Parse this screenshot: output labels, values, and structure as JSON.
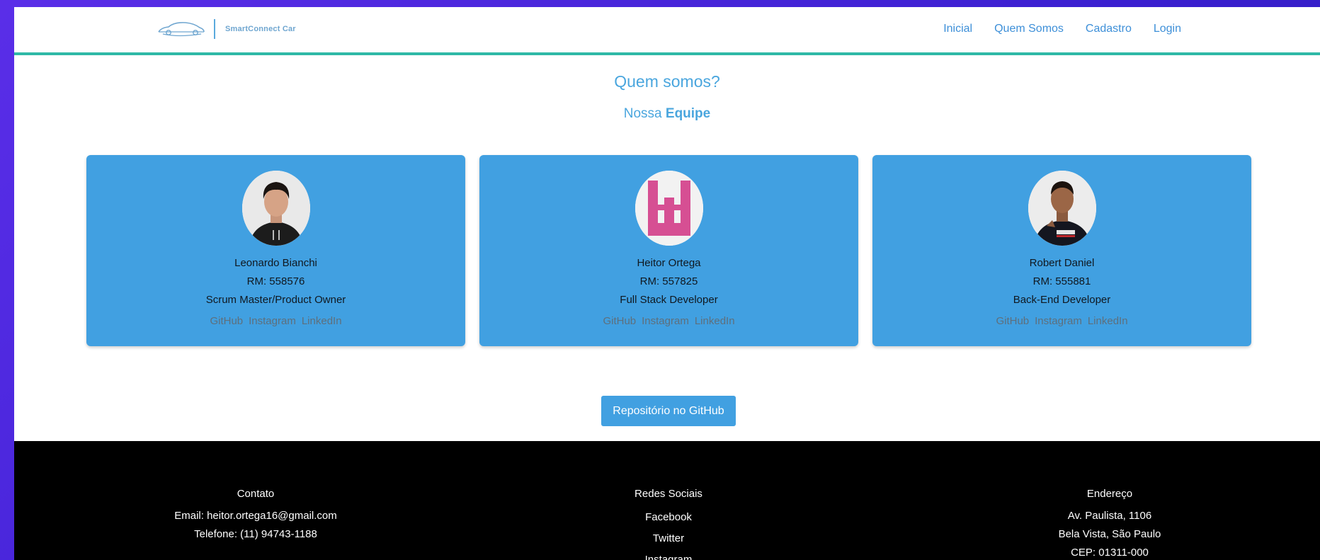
{
  "navbar": {
    "brand": "SmartConnect Car",
    "links": [
      "Inicial",
      "Quem Somos",
      "Cadastro",
      "Login"
    ],
    "accent": "#2fb9a7"
  },
  "main": {
    "title": "Quem somos?",
    "subtitle_prefix": "Nossa",
    "subtitle_bold": "Equipe",
    "members": [
      {
        "name": "Leonardo Bianchi",
        "rm": "RM: 558576",
        "role": "Scrum Master/Product Owner",
        "links": [
          "GitHub",
          "Instagram",
          "LinkedIn"
        ]
      },
      {
        "name": "Heitor Ortega",
        "rm": "RM: 557825",
        "role": "Full Stack Developer",
        "links": [
          "GitHub",
          "Instagram",
          "LinkedIn"
        ]
      },
      {
        "name": "Robert Daniel",
        "rm": "RM: 555881",
        "role": "Back-End Developer",
        "links": [
          "GitHub",
          "Instagram",
          "LinkedIn"
        ]
      }
    ],
    "repo_button": "Repositório no GitHub",
    "card_color": "#41a0e1"
  },
  "footer": {
    "contact": {
      "title": "Contato",
      "email": "Email: heitor.ortega16@gmail.com",
      "phone": "Telefone: (11) 94743-1188"
    },
    "social": {
      "title": "Redes Sociais",
      "items": [
        "Facebook",
        "Twitter",
        "Instagram"
      ]
    },
    "address": {
      "title": "Endereço",
      "line1": "Av. Paulista, 1106",
      "line2": "Bela Vista, São Paulo",
      "line3": "CEP: 01311-000"
    }
  }
}
